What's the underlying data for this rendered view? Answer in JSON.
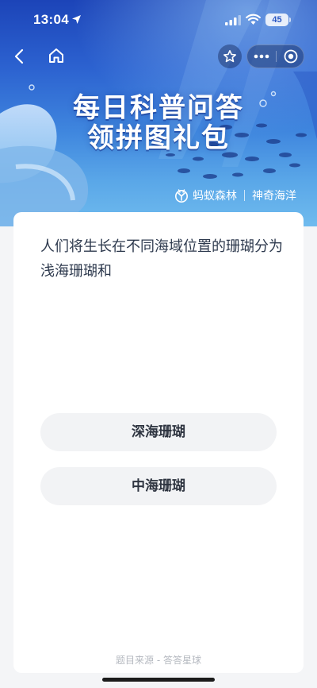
{
  "status_bar": {
    "time": "13:04",
    "battery": "45"
  },
  "hero": {
    "title_line1": "每日科普问答",
    "title_line2": "领拼图礼包",
    "brand_name": "蚂蚁森林",
    "partner_name": "神奇海洋"
  },
  "nav": {
    "back_icon": "chevron-left-icon",
    "home_icon": "home-icon",
    "favorite_icon": "star-icon",
    "more_icon": "more-dots-icon",
    "close_icon": "target-circle-icon"
  },
  "quiz": {
    "question": "人们将生长在不同海域位置的珊瑚分为浅海珊瑚和",
    "options": [
      {
        "label": "深海珊瑚"
      },
      {
        "label": "中海珊瑚"
      }
    ],
    "source": "题目来源 - 答答星球"
  },
  "colors": {
    "hero_top": "#1c44b8",
    "hero_bottom": "#6fbbee",
    "page_bg": "#f4f5f7",
    "option_bg": "#f2f3f5",
    "question_text": "#2e3a4e"
  }
}
